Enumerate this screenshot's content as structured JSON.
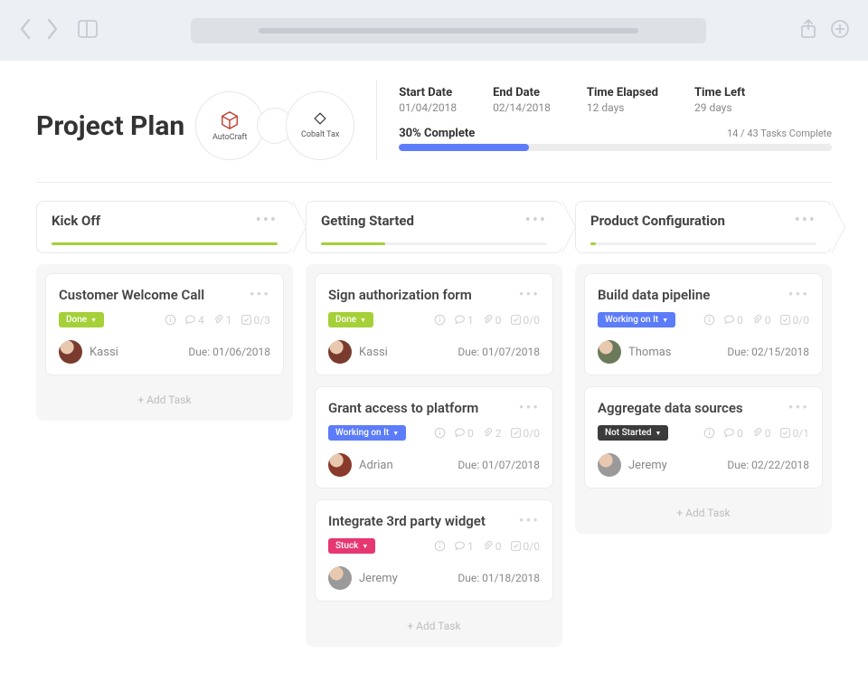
{
  "header": {
    "title": "Project Plan",
    "logos": [
      {
        "name": "AutoCraft",
        "color": "#c0392b"
      },
      {
        "name": "Cobalt Tax",
        "color": "#333"
      }
    ]
  },
  "stats": {
    "startDate": {
      "label": "Start Date",
      "value": "01/04/2018"
    },
    "endDate": {
      "label": "End Date",
      "value": "02/14/2018"
    },
    "elapsed": {
      "label": "Time Elapsed",
      "value": "12 days"
    },
    "left": {
      "label": "Time Left",
      "value": "29 days"
    },
    "progressLabel": "30% Complete",
    "progressPct": 30,
    "tasksLabel": "14 / 43 Tasks Complete"
  },
  "addTaskLabel": "+ Add Task",
  "columns": [
    {
      "title": "Kick Off",
      "accentPct": 100,
      "tasks": [
        {
          "title": "Customer Welcome Call",
          "status": "Done",
          "statusClass": "status-done",
          "comments": "4",
          "attachments": "1",
          "check": "0/3",
          "assignee": "Kassi",
          "avatarColor": "#7a3b2e",
          "due": "Due: 01/06/2018"
        }
      ]
    },
    {
      "title": "Getting Started",
      "accentPct": 25,
      "tasks": [
        {
          "title": "Sign authorization form",
          "status": "Done",
          "statusClass": "status-done",
          "comments": "1",
          "attachments": "0",
          "check": "0/0",
          "assignee": "Kassi",
          "avatarColor": "#7a3b2e",
          "due": "Due: 01/07/2018"
        },
        {
          "title": "Grant access to platform",
          "status": "Working on It",
          "statusClass": "status-working",
          "comments": "0",
          "attachments": "2",
          "check": "0/0",
          "assignee": "Adrian",
          "avatarColor": "#8a3a2a",
          "due": "Due: 01/07/2018"
        },
        {
          "title": "Integrate 3rd party widget",
          "status": "Stuck",
          "statusClass": "status-stuck",
          "comments": "1",
          "attachments": "0",
          "check": "0/0",
          "assignee": "Jeremy",
          "avatarColor": "#9a9a9a",
          "due": "Due: 01/18/2018"
        }
      ]
    },
    {
      "title": "Product Configuration",
      "accentPct": 2,
      "tasks": [
        {
          "title": "Build data pipeline",
          "status": "Working on It",
          "statusClass": "status-working",
          "comments": "0",
          "attachments": "0",
          "check": "0/0",
          "assignee": "Thomas",
          "avatarColor": "#6b7a5a",
          "due": "Due: 02/15/2018"
        },
        {
          "title": "Aggregate data sources",
          "status": "Not Started",
          "statusClass": "status-notstarted",
          "comments": "0",
          "attachments": "0",
          "check": "0/1",
          "assignee": "Jeremy",
          "avatarColor": "#9a9a9a",
          "due": "Due: 02/22/2018"
        }
      ]
    }
  ]
}
